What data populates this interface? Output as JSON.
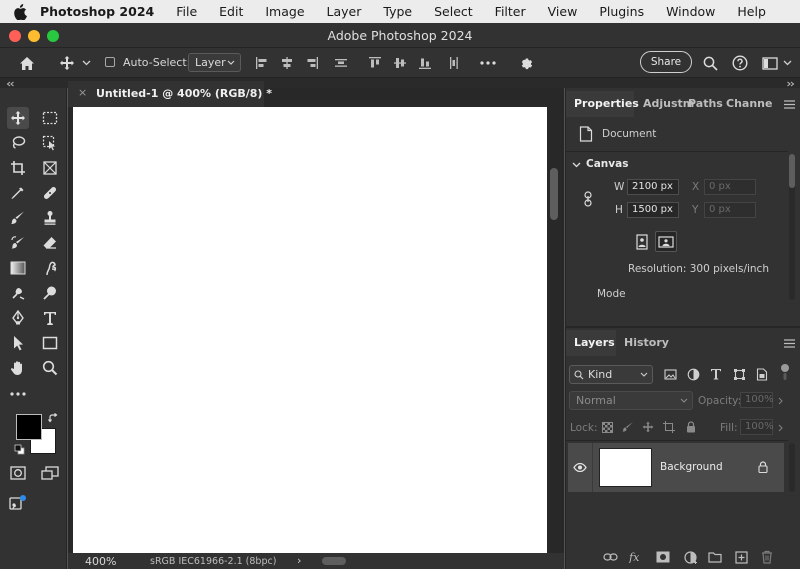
{
  "menubar": {
    "app_name": "Photoshop 2024",
    "items": [
      "File",
      "Edit",
      "Image",
      "Layer",
      "Type",
      "Select",
      "Filter",
      "View",
      "Plugins",
      "Window",
      "Help"
    ]
  },
  "window": {
    "title": "Adobe Photoshop 2024"
  },
  "options": {
    "auto_select_label": "Auto-Select:",
    "auto_select_value": "Layer",
    "share_label": "Share"
  },
  "document": {
    "tab_title": "Untitled-1 @ 400% (RGB/8) *",
    "zoom": "400%",
    "profile": "sRGB IEC61966-2.1 (8bpc)"
  },
  "properties": {
    "tabs": [
      "Properties",
      "Adjustm",
      "Paths",
      "Channe"
    ],
    "document_label": "Document",
    "canvas_label": "Canvas",
    "width_label": "W",
    "width_value": "2100 px",
    "height_label": "H",
    "height_value": "1500 px",
    "x_label": "X",
    "x_placeholder": "0 px",
    "y_label": "Y",
    "y_placeholder": "0 px",
    "resolution": "Resolution: 300 pixels/inch",
    "mode_label": "Mode"
  },
  "layers": {
    "tabs": [
      "Layers",
      "History"
    ],
    "kind_label": "Kind",
    "blend_mode": "Normal",
    "opacity_label": "Opacity:",
    "opacity_value": "100%",
    "lock_label": "Lock:",
    "fill_label": "Fill:",
    "fill_value": "100%",
    "layer_name": "Background"
  },
  "colors": {
    "foreground": "#000000",
    "background": "#ffffff",
    "accent_close": "#fe5f57",
    "accent_min": "#febc2e",
    "accent_max": "#28c840"
  }
}
